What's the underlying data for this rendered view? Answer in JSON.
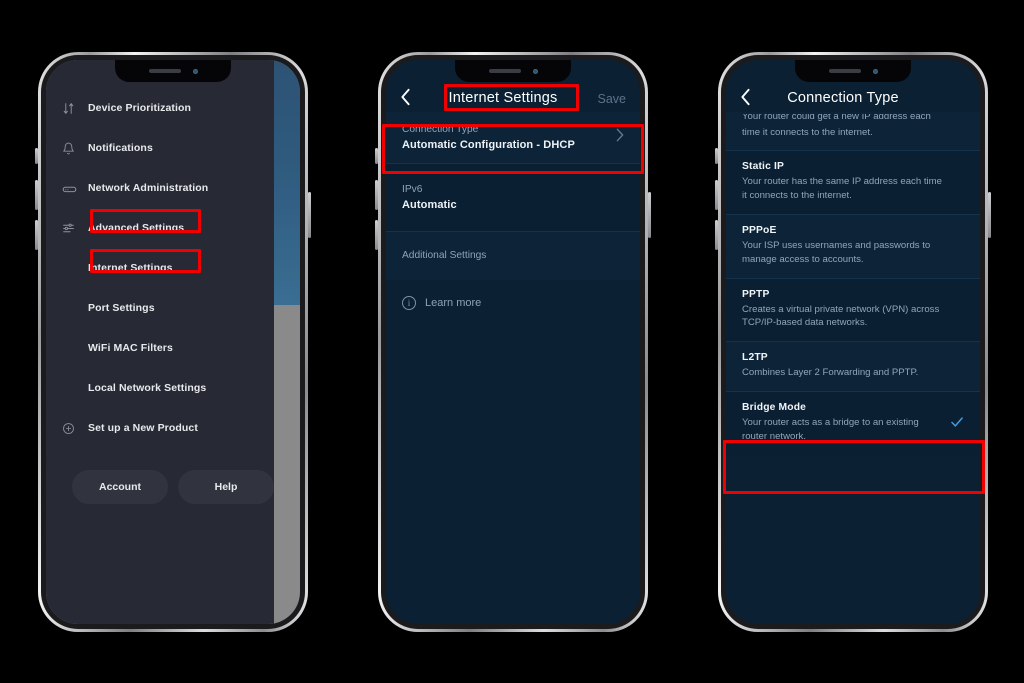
{
  "phone1": {
    "screen_name": "Linksys app navigation drawer",
    "nav_items": [
      {
        "label": "Device Prioritization",
        "icon": "arrows-up-down-icon",
        "highlighted": false
      },
      {
        "label": "Notifications",
        "icon": "bell-icon",
        "highlighted": false
      },
      {
        "label": "Network Administration",
        "icon": "router-icon",
        "highlighted": false
      },
      {
        "label": "Advanced Settings",
        "icon": "sliders-icon",
        "highlighted": true
      },
      {
        "label": "Internet Settings",
        "icon": "",
        "highlighted": true
      },
      {
        "label": "Port Settings",
        "icon": "",
        "highlighted": false
      },
      {
        "label": "WiFi MAC Filters",
        "icon": "",
        "highlighted": false
      },
      {
        "label": "Local Network Settings",
        "icon": "",
        "highlighted": false
      },
      {
        "label": "Set up a New Product",
        "icon": "plus-circle-icon",
        "highlighted": false
      }
    ],
    "buttons": [
      {
        "label": "Account"
      },
      {
        "label": "Help"
      }
    ]
  },
  "phone2": {
    "appbar": {
      "back_icon": "chevron-left-icon",
      "title": "Internet Settings",
      "action": "Save"
    },
    "rows": [
      {
        "key": "Connection Type",
        "value": "Automatic Configuration - DHCP",
        "chevron": "chevron-right-icon",
        "highlighted": true
      },
      {
        "key": "IPv6",
        "value": "Automatic",
        "chevron": "",
        "highlighted": false
      },
      {
        "key": "Additional Settings",
        "value": "",
        "chevron": "",
        "highlighted": false
      }
    ],
    "learn_more": {
      "icon": "info-icon",
      "label": "Learn more"
    }
  },
  "phone3": {
    "appbar": {
      "back_icon": "chevron-left-icon",
      "title": "Connection Type"
    },
    "clipped_top": {
      "line1": "Your router could get a new IP address each",
      "line2": "time it connects to the internet."
    },
    "options": [
      {
        "title": "Static IP",
        "desc": "Your router has the same IP address each time it connects to the internet.",
        "selected": false,
        "highlighted": false
      },
      {
        "title": "PPPoE",
        "desc": "Your ISP uses usernames and passwords to manage access to accounts.",
        "selected": false,
        "highlighted": false
      },
      {
        "title": "PPTP",
        "desc": "Creates a virtual private network (VPN) across TCP/IP-based data networks.",
        "selected": false,
        "highlighted": false
      },
      {
        "title": "L2TP",
        "desc": "Combines Layer 2 Forwarding and PPTP.",
        "selected": false,
        "highlighted": false
      },
      {
        "title": "Bridge Mode",
        "desc": "Your router acts as a bridge to an existing router network.",
        "selected": true,
        "check_icon": "check-icon",
        "highlighted": true
      }
    ]
  },
  "colors": {
    "annotation": "#f00000",
    "accent_check": "#3f9bdc",
    "drawer_bg": "#272a35",
    "app_bg": "#0b2033",
    "page_bg": "#000000"
  }
}
